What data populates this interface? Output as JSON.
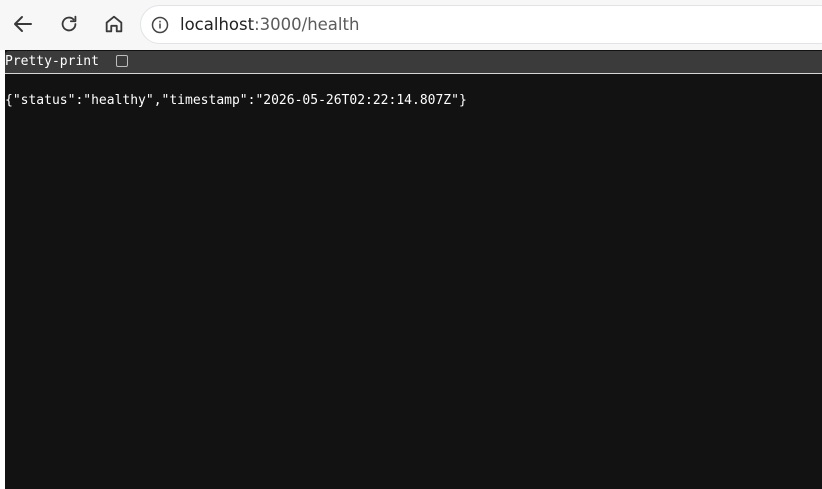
{
  "browser": {
    "back_icon": "arrow-left-icon",
    "reload_icon": "reload-icon",
    "home_icon": "home-icon",
    "info_icon": "info-icon",
    "url_host": "localhost",
    "url_port_path": ":3000/health"
  },
  "json_viewer": {
    "pretty_print_label": "Pretty-print",
    "pretty_print_checked": false,
    "body_text": "{\"status\":\"healthy\",\"timestamp\":\"2026-05-26T02:22:14.807Z\"}"
  },
  "colors": {
    "toolbar_bg": "#f7f7f7",
    "viewer_bg": "#121212",
    "pretty_bar_bg": "#3b3b3b",
    "text_light": "#ffffff"
  }
}
